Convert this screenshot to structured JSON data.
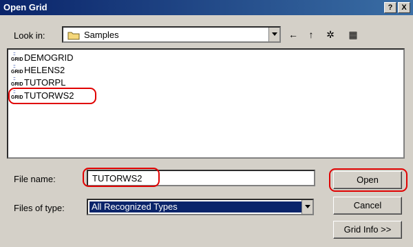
{
  "title": "Open Grid",
  "title_buttons": {
    "help": "?",
    "close": "X"
  },
  "look_in": {
    "label": "Look in:",
    "value": "Samples"
  },
  "toolbar": [
    {
      "name": "back-arrow-icon",
      "glyph": "←"
    },
    {
      "name": "up-folder-icon",
      "glyph": "↑"
    },
    {
      "name": "new-folder-icon",
      "glyph": "✲"
    },
    {
      "name": "view-menu-icon",
      "glyph": "▦"
    }
  ],
  "files": [
    {
      "name": "DEMOGRID",
      "icon": "grid-file-icon"
    },
    {
      "name": "HELENS2",
      "icon": "grid-file-icon"
    },
    {
      "name": "TUTORPL",
      "icon": "grid-file-icon"
    },
    {
      "name": "TUTORWS2",
      "icon": "grid-file-icon"
    }
  ],
  "icon_text": {
    "dots": ":::",
    "word": "GRID"
  },
  "file_name": {
    "label": "File name:",
    "value": "TUTORWS2"
  },
  "file_type": {
    "label": "Files of type:",
    "value": "All Recognized Types"
  },
  "buttons": {
    "open": "Open",
    "cancel": "Cancel",
    "grid_info": "Grid Info >>"
  }
}
